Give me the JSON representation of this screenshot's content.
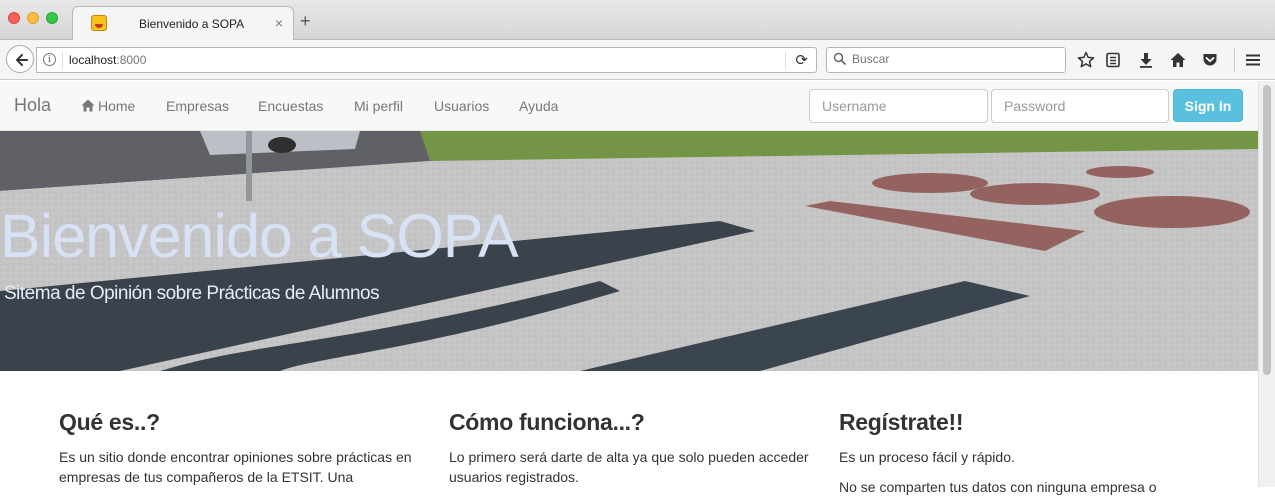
{
  "browser": {
    "tab_title": "Bienvenido a SOPA",
    "tab_close": "×",
    "new_tab": "+",
    "url_host": "localhost",
    "url_port": ":8000",
    "search_placeholder": "Buscar",
    "info_glyph": "i",
    "reload_glyph": "⟳",
    "toolbar_icons": [
      "star-icon",
      "reading-list-icon",
      "download-icon",
      "home-icon",
      "pocket-icon",
      "menu-icon"
    ]
  },
  "site_nav": {
    "brand": "Hola",
    "links": [
      "Home",
      "Empresas",
      "Encuestas",
      "Mi perfil",
      "Usuarios",
      "Ayuda"
    ],
    "username_placeholder": "Username",
    "password_placeholder": "Password",
    "signin_label": "Sign In"
  },
  "hero": {
    "title": "Bienvenido a SOPA",
    "subtitle": "Sitema de Opinión sobre Prácticas de Alumnos"
  },
  "columns": [
    {
      "heading": "Qué es..?",
      "paragraphs": [
        "Es un sitio donde encontrar opiniones sobre prácticas en empresas de tus compañeros de la ETSIT. Una"
      ]
    },
    {
      "heading": "Cómo funciona...?",
      "paragraphs": [
        "Lo primero será darte de alta ya que solo pueden acceder usuarios registrados."
      ]
    },
    {
      "heading": "Regístrate!!",
      "paragraphs": [
        "Es un proceso fácil y rápido.",
        "No se comparten tus datos con ninguna empresa o"
      ]
    }
  ],
  "colors": {
    "accent_signin": "#5bc0de",
    "hero_title": "#d8e2f5"
  }
}
